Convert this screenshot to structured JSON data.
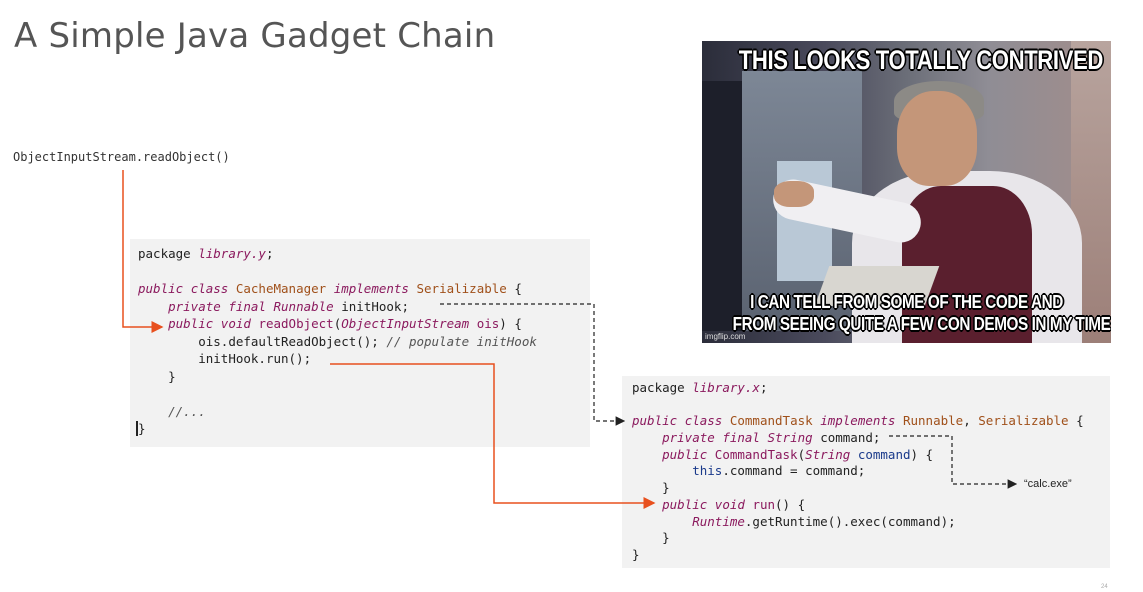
{
  "slide": {
    "title": "A Simple Java Gadget Chain",
    "page_number": "24",
    "entry_point": "ObjectInputStream.readObject()",
    "calc_label": "“calc.exe”"
  },
  "meme": {
    "top_text": "THIS LOOKS TOTALLY CONTRIVED",
    "bottom_text_1": "I CAN TELL FROM SOME OF THE CODE AND",
    "bottom_text_2": "FROM SEEING QUITE A FEW CON DEMOS IN MY TIME",
    "watermark": "imgflip.com"
  },
  "code_library_y": {
    "package_kw": "package",
    "package_name": "library.y",
    "class_decl": {
      "public": "public",
      "class": "class",
      "name": "CacheManager",
      "implements": "implements",
      "iface": "Serializable"
    },
    "field": {
      "private": "private",
      "final": "final",
      "type": "Runnable",
      "name": "initHook;"
    },
    "method": {
      "public": "public",
      "void": "void",
      "name": "readObject",
      "param_type": "ObjectInputStream",
      "param": "ois"
    },
    "default_read": "ois.defaultReadObject();",
    "default_read_comment": "// populate initHook",
    "run_call": "initHook.run();",
    "ellipsis": "//..."
  },
  "code_library_x": {
    "package_kw": "package",
    "package_name": "library.x",
    "class_decl": {
      "public": "public",
      "class": "class",
      "name": "CommandTask",
      "implements": "implements",
      "iface1": "Runnable",
      "iface2": "Serializable"
    },
    "field": {
      "private": "private",
      "final": "final",
      "type": "String",
      "name": "command;"
    },
    "ctor": {
      "public": "public",
      "name": "CommandTask",
      "param_type": "String",
      "param": "command"
    },
    "ctor_body_this": "this",
    "ctor_body_rest": ".command = command;",
    "run": {
      "public": "public",
      "void": "void",
      "name": "run"
    },
    "runtime_class": "Runtime",
    "runtime_call": ".getRuntime().exec(command);"
  },
  "colors": {
    "arrow_solid": "#e8501e",
    "arrow_dashed": "#222222",
    "code_bg": "#f2f2f2",
    "keyword": "#8b1a5e",
    "title": "#555555"
  }
}
